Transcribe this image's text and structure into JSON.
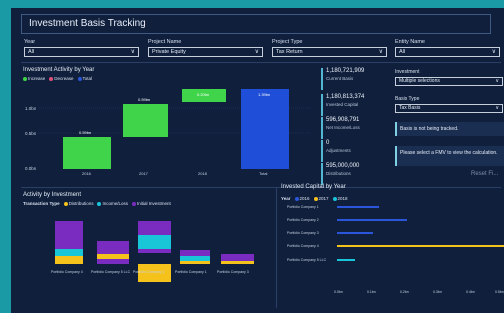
{
  "title": "Investment Basis Tracking",
  "filters": [
    {
      "label": "Year",
      "value": "All"
    },
    {
      "label": "Project Name",
      "value": "Private Equity"
    },
    {
      "label": "Project Type",
      "value": "Tax Return"
    },
    {
      "label": "Entity Name",
      "value": "All"
    }
  ],
  "activity_by_year": {
    "title": "Investment Activity by Year",
    "legend": [
      {
        "label": "Increase",
        "color": "#3fd44a"
      },
      {
        "label": "Decrease",
        "color": "#e0507a"
      },
      {
        "label": "Total",
        "color": "#2b56d9"
      }
    ],
    "y_ticks": [
      "1.5bn",
      "1.0bn",
      "0.5bn",
      "0.0bn"
    ],
    "bars": [
      {
        "label": "2016",
        "value_label": "0.59bn",
        "type": "increase"
      },
      {
        "label": "2017",
        "value_label": "0.59bn",
        "type": "increase"
      },
      {
        "label": "2018",
        "value_label": "0.20bn",
        "type": "increase"
      },
      {
        "label": "Total",
        "value_label": "1.39bn",
        "type": "total"
      }
    ]
  },
  "kpis": [
    {
      "value": "1,180,721,909",
      "label": "Current Basis"
    },
    {
      "value": "1,180,813,374",
      "label": "Invested Capital"
    },
    {
      "value": "596,908,791",
      "label": "Net Income/Loss"
    },
    {
      "value": "0",
      "label": "Adjustments"
    },
    {
      "value": "595,000,000",
      "label": "Distributions"
    }
  ],
  "investment_select": {
    "label": "Investment",
    "value": "Multiple selections"
  },
  "basis_type_select": {
    "label": "Basis Type",
    "value": "Tax Basis"
  },
  "messages": [
    "Basis is not being tracked.",
    "Please select a FMV to view the calculation."
  ],
  "reset_label": "Reset Fi...",
  "activity_by_investment": {
    "title": "Activity by Investment",
    "legend_title": "Transaction Type",
    "legend": [
      {
        "label": "Distributions",
        "color": "#f5c21b"
      },
      {
        "label": "Income/Loss",
        "color": "#18c6d8"
      },
      {
        "label": "Initial Investment",
        "color": "#7b2cc0"
      }
    ],
    "categories": [
      "Portfolio Company 4",
      "Portfolio Company 5 LLC",
      "Portfolio Company 2",
      "Portfolio Company 1",
      "Portfolio Company 3"
    ]
  },
  "invested_by_year": {
    "title": "Invested Capital by Year",
    "legend_title": "Year",
    "legend": [
      {
        "label": "2016",
        "color": "#2b56d9"
      },
      {
        "label": "2017",
        "color": "#f5c21b"
      },
      {
        "label": "2018",
        "color": "#18c6d8"
      }
    ],
    "categories": [
      "Portfolio Company 1",
      "Portfolio Company 2",
      "Portfolio Company 3",
      "Portfolio Company 4",
      "Portfolio Company 5 LLC"
    ],
    "x_ticks": [
      "0.0bn",
      "0.1bn",
      "0.2bn",
      "0.3bn",
      "0.4bn",
      "0.5bn"
    ]
  }
}
